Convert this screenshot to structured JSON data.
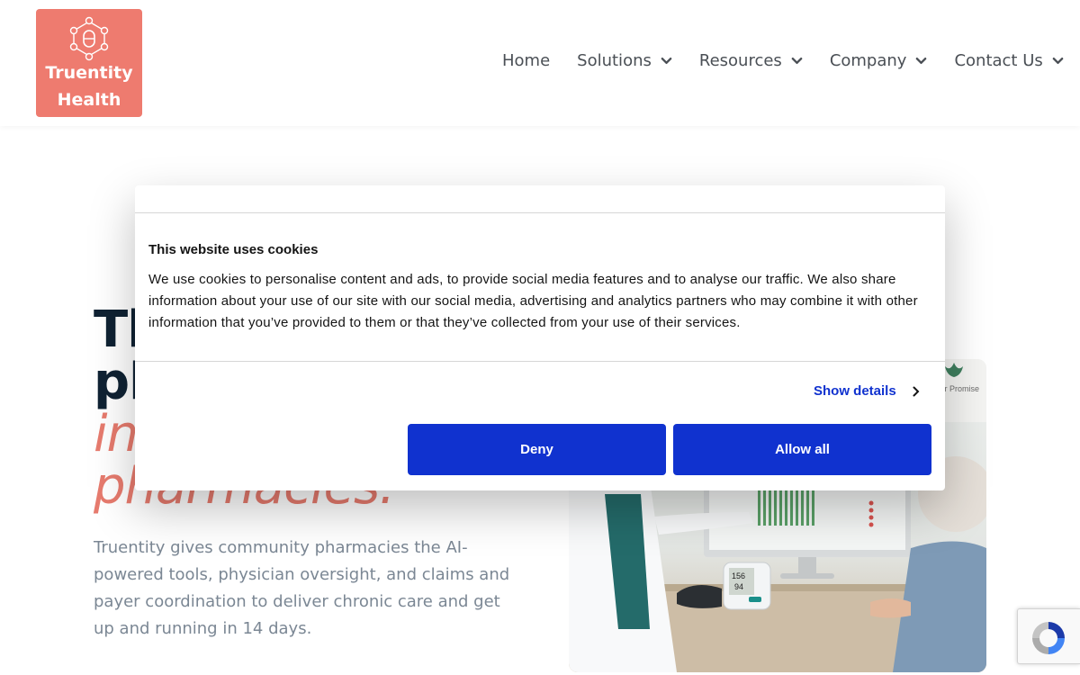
{
  "brand": {
    "name_line1": "Truentity",
    "name_line2": "Health",
    "logo_color": "#ee7b6f"
  },
  "nav": {
    "items": [
      {
        "label": "Home",
        "has_dropdown": false
      },
      {
        "label": "Solutions",
        "has_dropdown": true
      },
      {
        "label": "Resources",
        "has_dropdown": true
      },
      {
        "label": "Company",
        "has_dropdown": true
      },
      {
        "label": "Contact Us",
        "has_dropdown": true
      }
    ]
  },
  "hero": {
    "title_line1": "Th",
    "title_line2": "pl",
    "title_line3_accent": "in",
    "title_line4_accent": "pharmacies.",
    "description": "Truentity gives community pharmacies the AI-powered tools, physician oversight, and claims and payer coordination to deliver chronic care and get up and running in 14 days.",
    "image_sign_text": "Our Promise",
    "image_monitor_reading_sys": "156",
    "image_monitor_reading_dia": "94"
  },
  "cookie_banner": {
    "title": "This website uses cookies",
    "body": "We use cookies to personalise content and ads, to provide social media features and to analyse our traffic. We also share information about your use of our site with our social media, advertising and analytics partners who may combine it with other information that you’ve provided to them or that they’ve collected from your use of their services.",
    "show_details_label": "Show details",
    "deny_label": "Deny",
    "allow_all_label": "Allow all",
    "button_color": "#1032cf"
  },
  "colors": {
    "title_dark": "#0f2233",
    "accent": "#e77b6e",
    "body_text": "#7b8794"
  }
}
